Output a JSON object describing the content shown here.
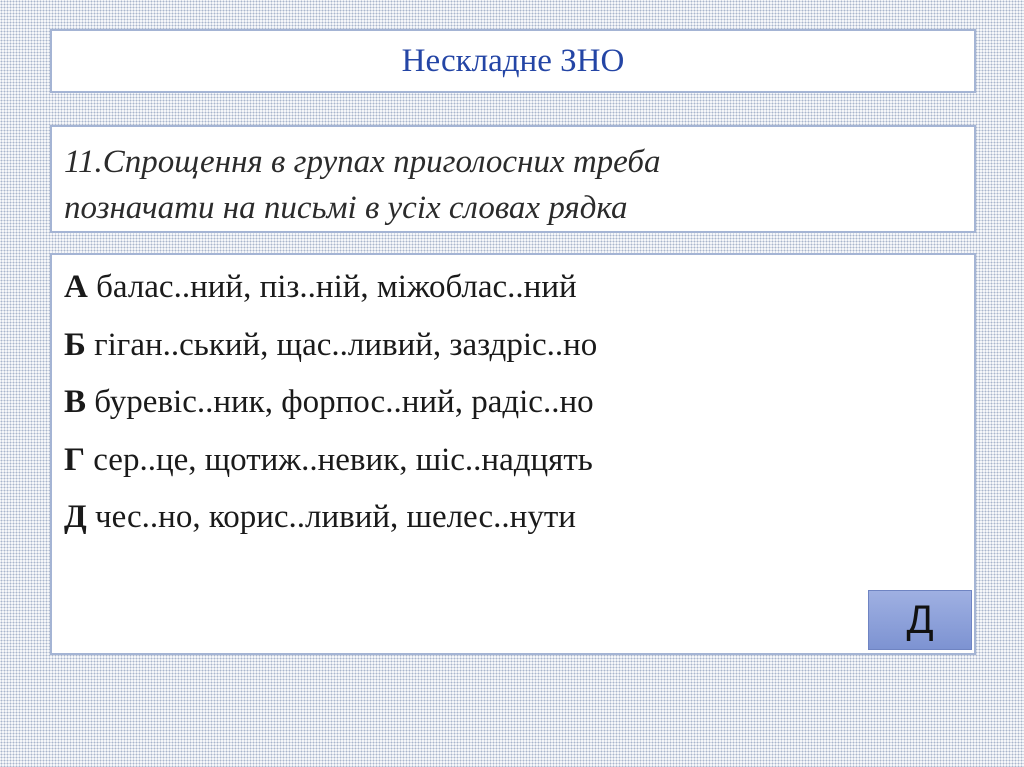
{
  "title": "Нескладне ЗНО",
  "question": {
    "line1": "11.Спрощення в групах приголосних треба",
    "line2": "позначати на письмі в усіх словах рядка"
  },
  "options": [
    {
      "letter": "А",
      "text": "балас..ний, піз..ній, міжоблас..ний"
    },
    {
      "letter": "Б",
      "text": "гіган..ський, щас..ливий, заздріс..но"
    },
    {
      "letter": "В",
      "text": "буревіс..ник, форпос..ний, радіс..но"
    },
    {
      "letter": "Г",
      "text": "сер..це, щотиж..невик, шіс..надцять"
    },
    {
      "letter": "Д",
      "text": "чес..но, корис..ливий, шелес..нути"
    }
  ],
  "answer_button": {
    "label": "Д"
  },
  "colors": {
    "title": "#2445a5",
    "border": "#a4b4d4",
    "button": "#8a9fdc"
  }
}
